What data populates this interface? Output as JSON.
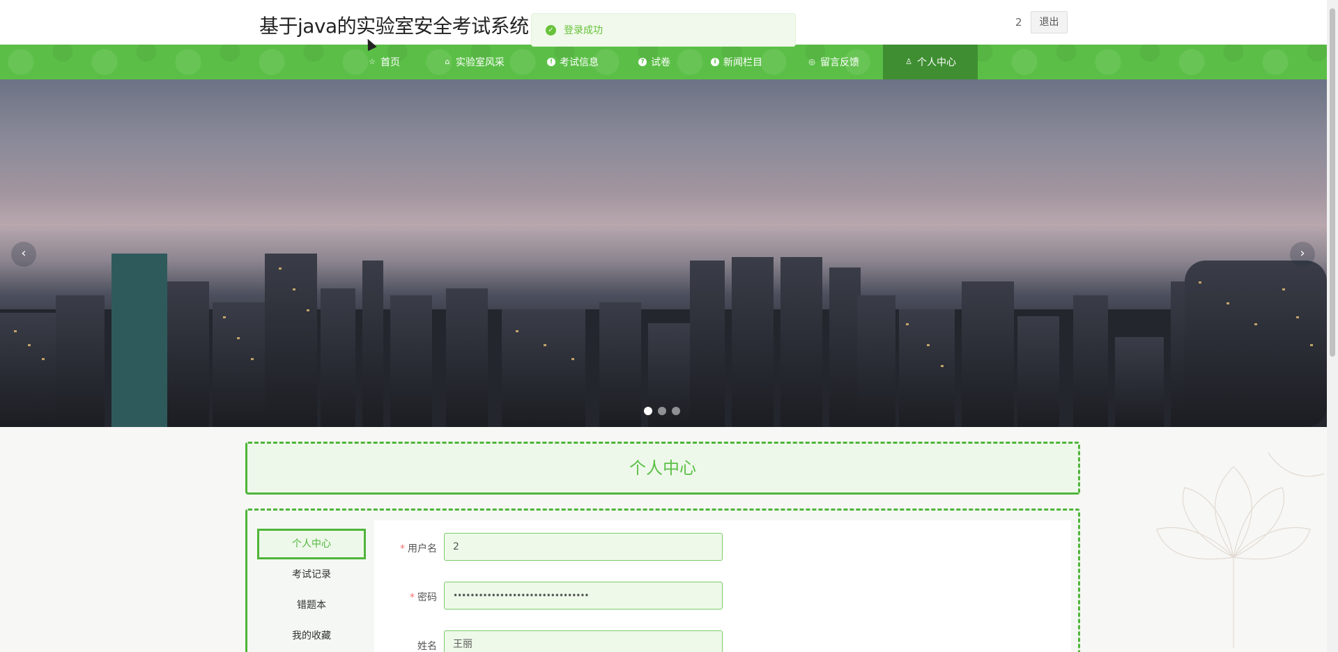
{
  "header": {
    "site_title": "基于java的实验室安全考试系统",
    "username": "2",
    "logout_label": "退出"
  },
  "toast": {
    "message": "登录成功"
  },
  "nav": {
    "items": [
      {
        "label": "首页",
        "icon": "star-icon"
      },
      {
        "label": "实验室风采",
        "icon": "bag-icon"
      },
      {
        "label": "考试信息",
        "icon": "info-icon"
      },
      {
        "label": "试卷",
        "icon": "help-icon"
      },
      {
        "label": "新闻栏目",
        "icon": "info-italic-icon"
      },
      {
        "label": "留言反馈",
        "icon": "globe-icon"
      },
      {
        "label": "个人中心",
        "icon": "user-icon"
      }
    ],
    "active_index": 6
  },
  "banner": {
    "slide_count": 3,
    "active_slide": 0
  },
  "page": {
    "title": "个人中心"
  },
  "side_menu": {
    "items": [
      "个人中心",
      "考试记录",
      "错题本",
      "我的收藏"
    ],
    "active_index": 0
  },
  "form": {
    "username_label": "用户名",
    "username_value": "2",
    "password_label": "密码",
    "password_value": "••••••••••••••••••••••••••••••••",
    "name_label": "姓名",
    "name_value": "王丽"
  },
  "colors": {
    "brand_green": "#5bbf47",
    "nav_active": "#3f8f32",
    "success": "#67c23a",
    "required": "#f56c6c"
  }
}
